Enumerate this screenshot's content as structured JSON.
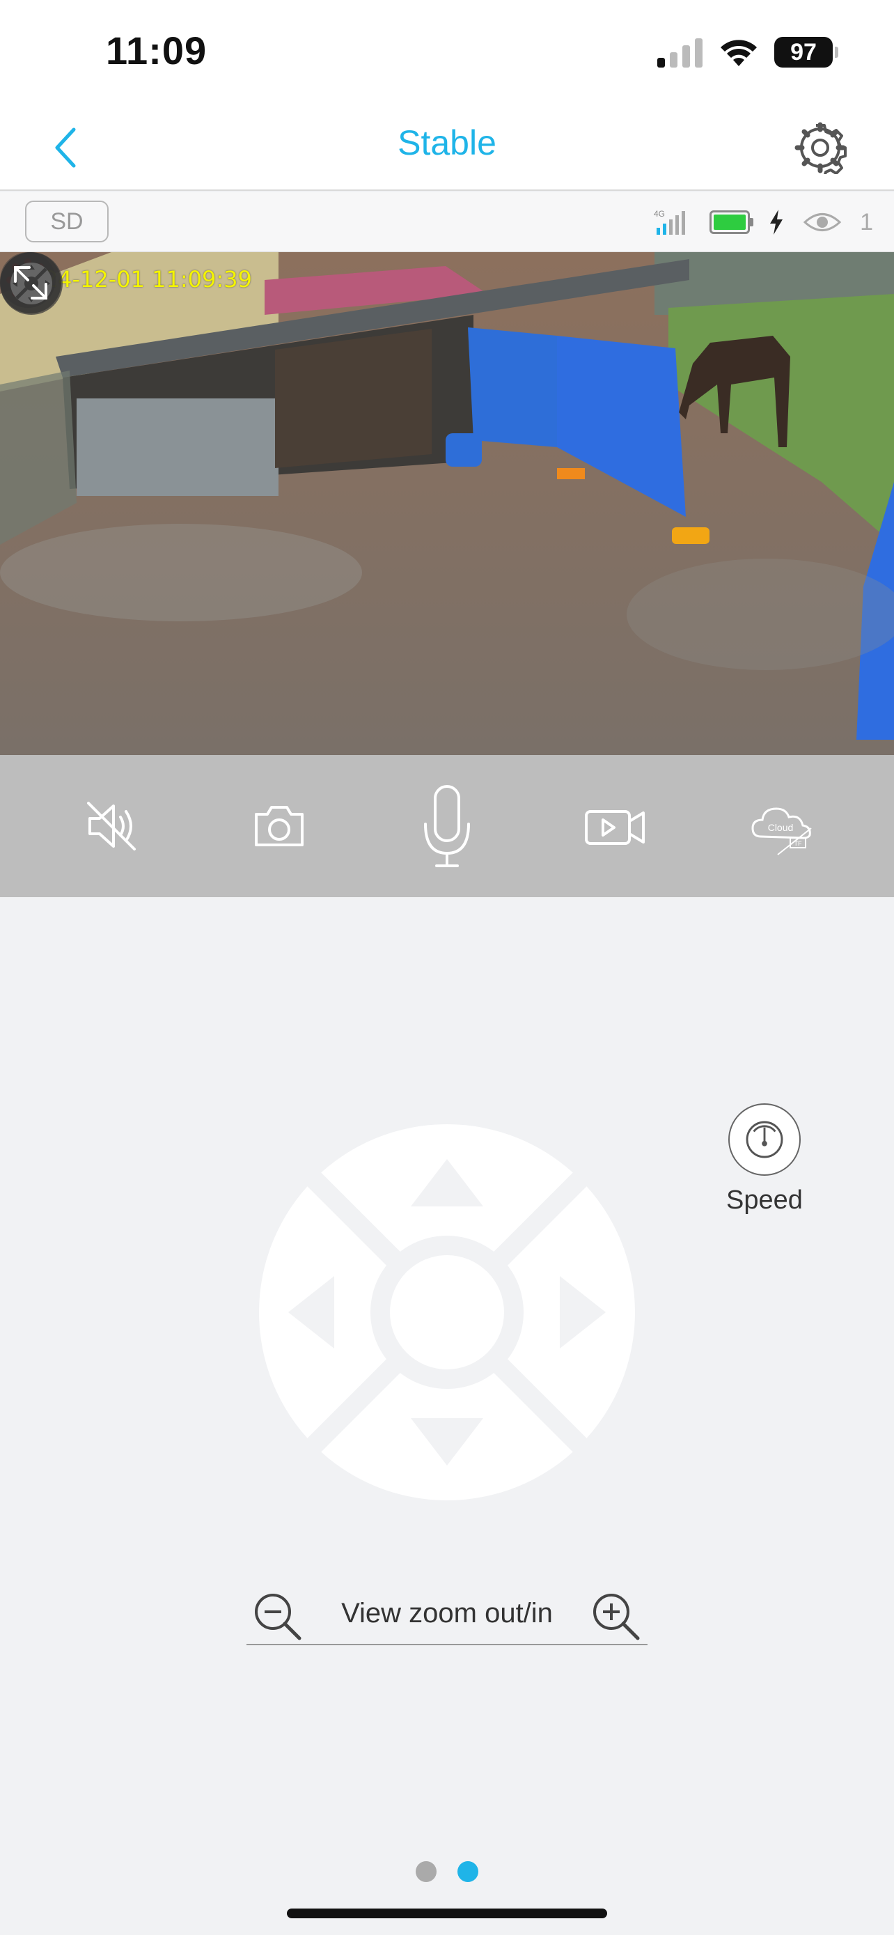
{
  "status_bar": {
    "time": "11:09",
    "battery": "97"
  },
  "nav": {
    "title": "Stable"
  },
  "info_bar": {
    "sd_label": "SD",
    "network": "4G",
    "viewers": "1"
  },
  "feed": {
    "timestamp": "2024-12-01 11:09:39"
  },
  "toolbar": {
    "cloud_label": "Cloud",
    "tf_label": "TF"
  },
  "ptz": {
    "speed_label": "Speed",
    "zoom_label": "View zoom out/in"
  },
  "pager": {
    "pages": 2,
    "active_index": 1
  },
  "colors": {
    "accent": "#1fb4e8",
    "toolbar_bg": "#bdbdbd",
    "page_bg": "#f1f2f4",
    "timestamp": "#f4f400"
  }
}
